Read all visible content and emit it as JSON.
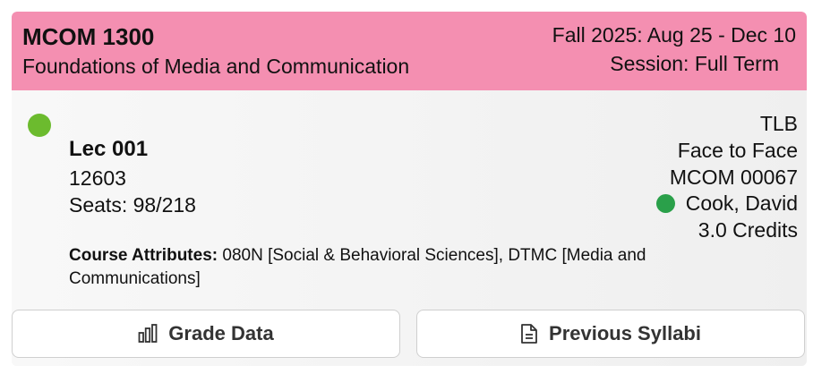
{
  "course": {
    "code": "MCOM 1300",
    "title": "Foundations of Media and Communication",
    "term": "Fall 2025: Aug 25 - Dec 10",
    "session": "Session: Full Term"
  },
  "section": {
    "type": "Lec 001",
    "crn": "12603",
    "seats": "Seats: 98/218",
    "status_color": "#6cbb2e",
    "building": "TLB",
    "mode": "Face to Face",
    "alt_code": "MCOM 00067",
    "instructor": "Cook, David",
    "instructor_status_color": "#2aa04a",
    "credits": "3.0 Credits",
    "attributes_label": "Course Attributes:",
    "attributes_value": " 080N [Social & Behavioral Sciences], DTMC [Media and Communications]"
  },
  "buttons": {
    "grade_data": {
      "label": "Grade Data",
      "icon": "bar-chart-icon"
    },
    "syllabi": {
      "label": "Previous Syllabi",
      "icon": "document-icon"
    }
  },
  "colors": {
    "header_bg": "#f48fb1"
  }
}
